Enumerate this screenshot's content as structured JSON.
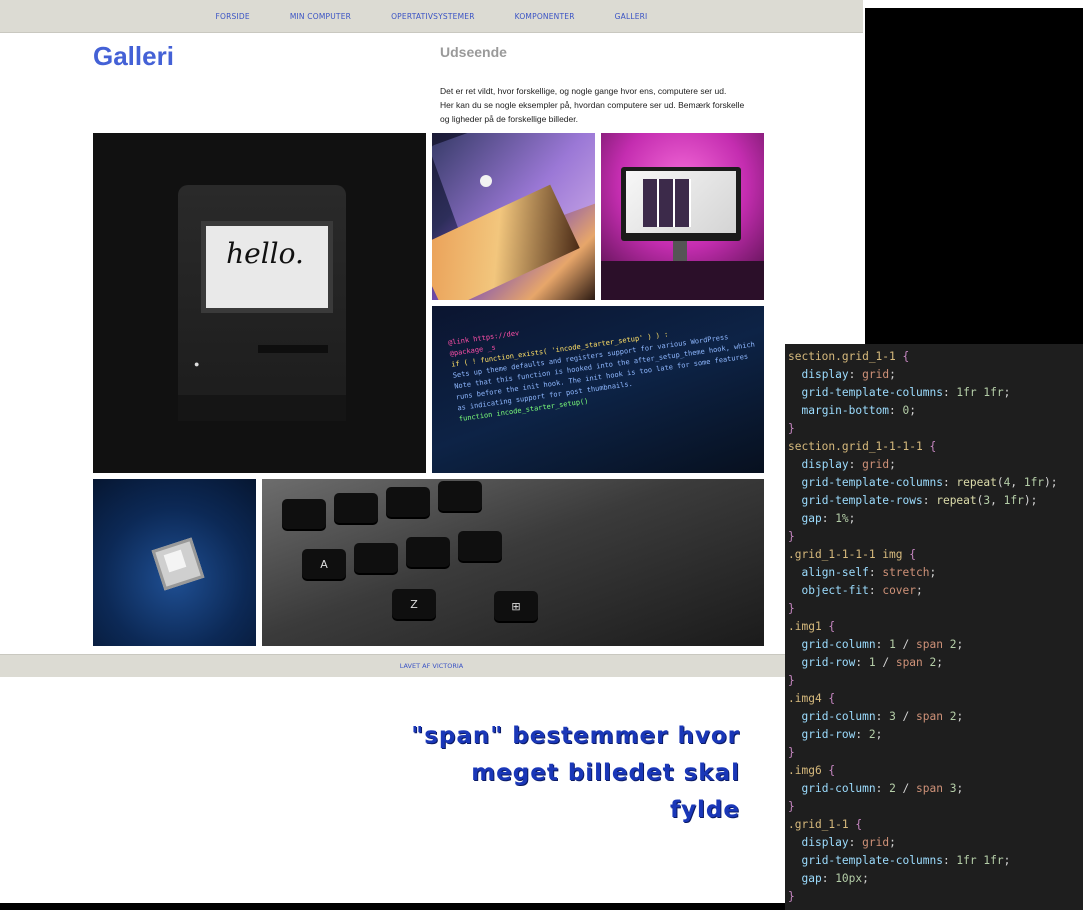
{
  "nav": {
    "items": [
      "FORSIDE",
      "MIN COMPUTER",
      "OPERTATIVSYSTEMER",
      "KOMPONENTER",
      "GALLERI"
    ]
  },
  "page": {
    "title": "Galleri",
    "section_title": "Udseende",
    "intro_lines": [
      "Det er ret vildt, hvor forskellige, og nogle gange hvor ens, computere ser ud.",
      "Her kan du se nogle eksempler på, hvordan computere ser ud. Bemærk forskelle",
      "og ligheder på de forskellige billeder."
    ]
  },
  "gallery": {
    "mac_screen_text": "hello.",
    "code_image_lines": [
      "@link https://dev",
      "@package _s",
      "if ( ! function_exists( 'incode_starter_setup' ) ) :",
      "Sets up theme defaults and registers support for various WordPress",
      "Note that this function is hooked into the after_setup_theme hook, which",
      "runs before the init hook. The init hook is too late for some features",
      "as indicating support for post thumbnails.",
      "function incode_starter_setup()"
    ],
    "keyboard_keys": [
      "A",
      "Z"
    ]
  },
  "footer": {
    "text": "LAVET AF VICTORIA"
  },
  "annotation": {
    "line1": "\"span\"  bestemmer hvor",
    "line2": "meget billedet skal fylde"
  },
  "colors": {
    "link": "#3a53c4",
    "title": "#4461d6",
    "navbar_bg": "#dcdbd3",
    "annotation": "#1a37b8",
    "editor_bg": "#1e1e1e"
  },
  "editor": {
    "lines": [
      [
        [
          "sel",
          "section.grid_1-1 "
        ],
        [
          "brace",
          "{"
        ]
      ],
      [
        [
          "plain",
          "  "
        ],
        [
          "prop",
          "display"
        ],
        [
          "plain",
          ": "
        ],
        [
          "val",
          "grid"
        ],
        [
          "plain",
          ";"
        ]
      ],
      [
        [
          "plain",
          "  "
        ],
        [
          "prop",
          "grid-template-columns"
        ],
        [
          "plain",
          ": "
        ],
        [
          "num",
          "1fr 1fr"
        ],
        [
          "plain",
          ";"
        ]
      ],
      [
        [
          "plain",
          "  "
        ],
        [
          "prop",
          "margin-bottom"
        ],
        [
          "plain",
          ": "
        ],
        [
          "num",
          "0"
        ],
        [
          "plain",
          ";"
        ]
      ],
      [
        [
          "brace",
          "}"
        ]
      ],
      [
        [
          "sel",
          "section.grid_1-1-1-1 "
        ],
        [
          "brace",
          "{"
        ]
      ],
      [
        [
          "plain",
          "  "
        ],
        [
          "prop",
          "display"
        ],
        [
          "plain",
          ": "
        ],
        [
          "val",
          "grid"
        ],
        [
          "plain",
          ";"
        ]
      ],
      [
        [
          "plain",
          "  "
        ],
        [
          "prop",
          "grid-template-columns"
        ],
        [
          "plain",
          ": "
        ],
        [
          "fn",
          "repeat"
        ],
        [
          "plain",
          "("
        ],
        [
          "num",
          "4"
        ],
        [
          "plain",
          ", "
        ],
        [
          "num",
          "1fr"
        ],
        [
          "plain",
          ");"
        ]
      ],
      [
        [
          "plain",
          "  "
        ],
        [
          "prop",
          "grid-template-rows"
        ],
        [
          "plain",
          ": "
        ],
        [
          "fn",
          "repeat"
        ],
        [
          "plain",
          "("
        ],
        [
          "num",
          "3"
        ],
        [
          "plain",
          ", "
        ],
        [
          "num",
          "1fr"
        ],
        [
          "plain",
          ");"
        ]
      ],
      [
        [
          "plain",
          "  "
        ],
        [
          "prop",
          "gap"
        ],
        [
          "plain",
          ": "
        ],
        [
          "num",
          "1%"
        ],
        [
          "plain",
          ";"
        ]
      ],
      [
        [
          "brace",
          "}"
        ]
      ],
      [
        [
          "sel",
          ".grid_1-1-1-1 img "
        ],
        [
          "brace",
          "{"
        ]
      ],
      [
        [
          "plain",
          "  "
        ],
        [
          "prop",
          "align-self"
        ],
        [
          "plain",
          ": "
        ],
        [
          "val",
          "stretch"
        ],
        [
          "plain",
          ";"
        ]
      ],
      [
        [
          "plain",
          "  "
        ],
        [
          "prop",
          "object-fit"
        ],
        [
          "plain",
          ": "
        ],
        [
          "val",
          "cover"
        ],
        [
          "plain",
          ";"
        ]
      ],
      [
        [
          "brace",
          "}"
        ]
      ],
      [
        [
          "sel",
          ".img1 "
        ],
        [
          "brace",
          "{"
        ]
      ],
      [
        [
          "plain",
          "  "
        ],
        [
          "prop",
          "grid-column"
        ],
        [
          "plain",
          ": "
        ],
        [
          "num",
          "1"
        ],
        [
          "plain",
          " / "
        ],
        [
          "val",
          "span"
        ],
        [
          "plain",
          " "
        ],
        [
          "num",
          "2"
        ],
        [
          "plain",
          ";"
        ]
      ],
      [
        [
          "plain",
          "  "
        ],
        [
          "prop",
          "grid-row"
        ],
        [
          "plain",
          ": "
        ],
        [
          "num",
          "1"
        ],
        [
          "plain",
          " / "
        ],
        [
          "val",
          "span"
        ],
        [
          "plain",
          " "
        ],
        [
          "num",
          "2"
        ],
        [
          "plain",
          ";"
        ]
      ],
      [
        [
          "brace",
          "}"
        ]
      ],
      [
        [
          "sel",
          ".img4 "
        ],
        [
          "brace",
          "{"
        ]
      ],
      [
        [
          "plain",
          "  "
        ],
        [
          "prop",
          "grid-column"
        ],
        [
          "plain",
          ": "
        ],
        [
          "num",
          "3"
        ],
        [
          "plain",
          " / "
        ],
        [
          "val",
          "span"
        ],
        [
          "plain",
          " "
        ],
        [
          "num",
          "2"
        ],
        [
          "plain",
          ";"
        ]
      ],
      [
        [
          "plain",
          "  "
        ],
        [
          "prop",
          "grid-row"
        ],
        [
          "plain",
          ": "
        ],
        [
          "num",
          "2"
        ],
        [
          "plain",
          ";"
        ]
      ],
      [
        [
          "brace",
          "}"
        ]
      ],
      [
        [
          "sel",
          ".img6 "
        ],
        [
          "brace",
          "{"
        ]
      ],
      [
        [
          "plain",
          "  "
        ],
        [
          "prop",
          "grid-column"
        ],
        [
          "plain",
          ": "
        ],
        [
          "num",
          "2"
        ],
        [
          "plain",
          " / "
        ],
        [
          "val",
          "span"
        ],
        [
          "plain",
          " "
        ],
        [
          "num",
          "3"
        ],
        [
          "plain",
          ";"
        ]
      ],
      [
        [
          "brace",
          "}"
        ]
      ],
      [
        [
          "sel",
          ".grid_1-1 "
        ],
        [
          "brace",
          "{"
        ]
      ],
      [
        [
          "plain",
          "  "
        ],
        [
          "prop",
          "display"
        ],
        [
          "plain",
          ": "
        ],
        [
          "val",
          "grid"
        ],
        [
          "plain",
          ";"
        ]
      ],
      [
        [
          "plain",
          "  "
        ],
        [
          "prop",
          "grid-template-columns"
        ],
        [
          "plain",
          ": "
        ],
        [
          "num",
          "1fr 1fr"
        ],
        [
          "plain",
          ";"
        ]
      ],
      [
        [
          "plain",
          "  "
        ],
        [
          "prop",
          "gap"
        ],
        [
          "plain",
          ": "
        ],
        [
          "num",
          "10px"
        ],
        [
          "plain",
          ";"
        ]
      ],
      [
        [
          "brace",
          "}"
        ]
      ]
    ]
  }
}
